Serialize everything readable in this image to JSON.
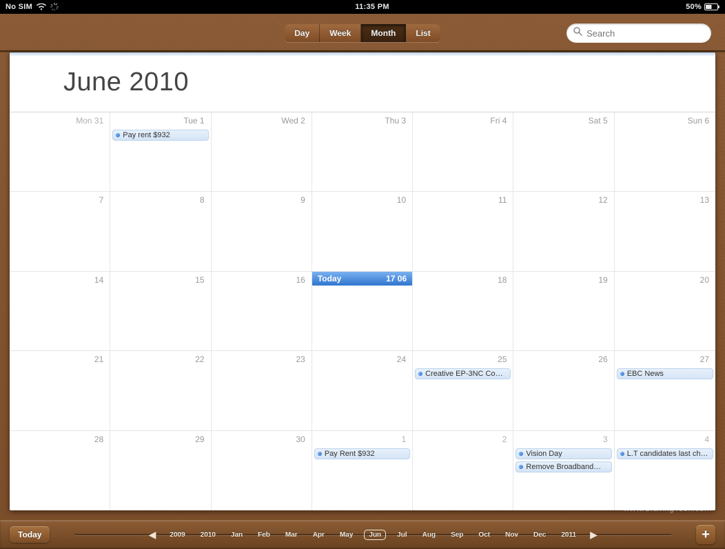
{
  "statusbar": {
    "sim": "No SIM",
    "time": "11:35 PM",
    "battery": "50%"
  },
  "tabs": {
    "items": [
      "Day",
      "Week",
      "Month",
      "List"
    ],
    "active": 2
  },
  "search": {
    "placeholder": "Search",
    "value": ""
  },
  "title": "June 2010",
  "weeks": [
    [
      {
        "label": "Mon 31",
        "dim": true,
        "events": []
      },
      {
        "label": "Tue 1",
        "dim": false,
        "events": [
          "Pay rent $932"
        ]
      },
      {
        "label": "Wed 2",
        "dim": false,
        "events": []
      },
      {
        "label": "Thu 3",
        "dim": false,
        "events": []
      },
      {
        "label": "Fri 4",
        "dim": false,
        "events": []
      },
      {
        "label": "Sat 5",
        "dim": false,
        "events": []
      },
      {
        "label": "Sun 6",
        "dim": false,
        "events": []
      }
    ],
    [
      {
        "label": "7",
        "events": []
      },
      {
        "label": "8",
        "events": []
      },
      {
        "label": "9",
        "events": []
      },
      {
        "label": "10",
        "events": []
      },
      {
        "label": "11",
        "events": []
      },
      {
        "label": "12",
        "events": []
      },
      {
        "label": "13",
        "events": []
      }
    ],
    [
      {
        "label": "14",
        "events": []
      },
      {
        "label": "15",
        "events": []
      },
      {
        "label": "16",
        "events": []
      },
      {
        "label": "17",
        "today": true,
        "today_left": "Today",
        "today_right": "17 06",
        "events": []
      },
      {
        "label": "18",
        "events": []
      },
      {
        "label": "19",
        "events": []
      },
      {
        "label": "20",
        "events": []
      }
    ],
    [
      {
        "label": "21",
        "events": []
      },
      {
        "label": "22",
        "events": []
      },
      {
        "label": "23",
        "events": []
      },
      {
        "label": "24",
        "events": []
      },
      {
        "label": "25",
        "events": [
          "Creative EP-3NC Co…"
        ]
      },
      {
        "label": "26",
        "events": []
      },
      {
        "label": "27",
        "events": [
          "EBC News"
        ]
      }
    ],
    [
      {
        "label": "28",
        "events": []
      },
      {
        "label": "29",
        "events": []
      },
      {
        "label": "30",
        "events": []
      },
      {
        "label": "1",
        "dim": true,
        "events": [
          "Pay Rent $932"
        ]
      },
      {
        "label": "2",
        "dim": true,
        "events": []
      },
      {
        "label": "3",
        "dim": true,
        "events": [
          "Vision Day",
          "Remove Broadband…"
        ]
      },
      {
        "label": "4",
        "dim": true,
        "events": [
          "L.T candidates last ch…"
        ]
      }
    ]
  ],
  "bottom": {
    "today": "Today",
    "years_pre": [
      "2009",
      "2010"
    ],
    "months": [
      "Jan",
      "Feb",
      "Mar",
      "Apr",
      "May",
      "Jun",
      "Jul",
      "Aug",
      "Sep",
      "Oct",
      "Nov",
      "Dec"
    ],
    "active_month": 5,
    "years_post": [
      "2011"
    ]
  },
  "watermark": "www.CravingTech.com"
}
